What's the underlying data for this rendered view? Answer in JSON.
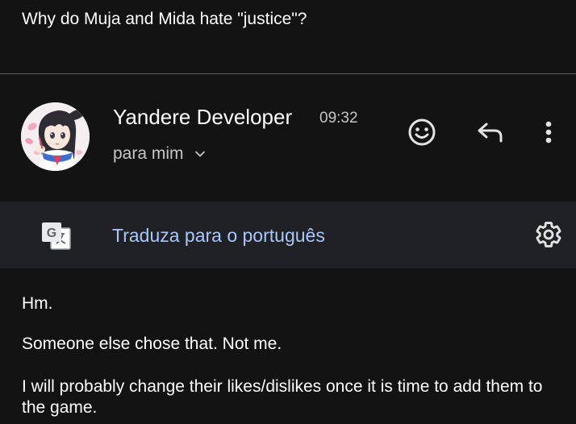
{
  "email": {
    "subject": "Why do Muja and Mida hate \"justice\"?",
    "sender": {
      "name": "Yandere Developer",
      "time": "09:32",
      "recipient_label": "para mim"
    },
    "actions": {
      "emoji": "add-reaction",
      "reply": "reply",
      "more": "more-options"
    },
    "translate": {
      "link_text": "Traduza para o português",
      "icon": "translate-icon",
      "settings_icon": "settings-icon"
    },
    "body": [
      "Hm.",
      "Someone else chose that. Not me.",
      "I will probably change their likes/dislikes once it is time to add them to the game."
    ]
  },
  "colors": {
    "background": "#131314",
    "translate_bar": "#202124",
    "link": "#a8c7fa",
    "secondary_text": "#c4c7c5",
    "divider": "#5f6368"
  }
}
